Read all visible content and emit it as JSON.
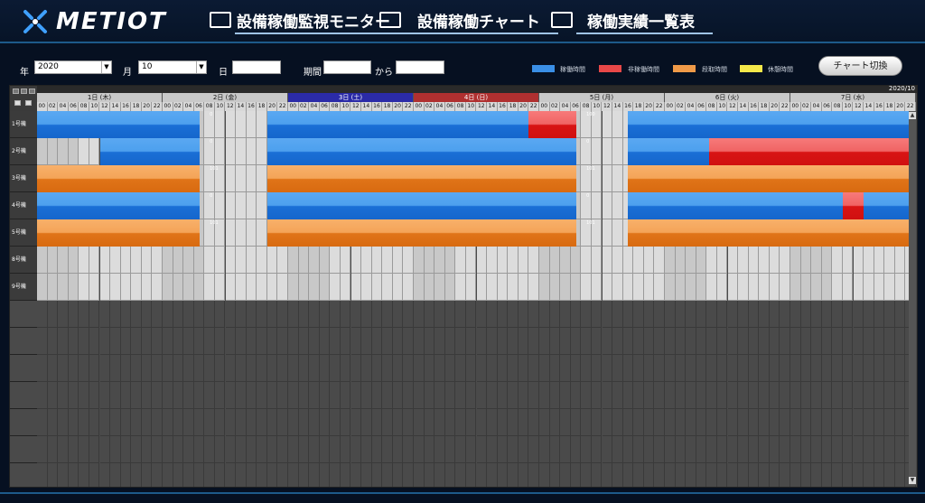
{
  "app": {
    "logo_text": "METIOT"
  },
  "nav": [
    {
      "label": "設備稼働監視モニター",
      "icon": "monitor-icon"
    },
    {
      "label": "設備稼働チャート",
      "icon": "chart-icon"
    },
    {
      "label": "稼働実績一覧表",
      "icon": "list-icon"
    }
  ],
  "filter": {
    "year_label": "年",
    "year_value": "2020",
    "month_label": "月",
    "month_value": "10",
    "day_label": "日",
    "day_value": "",
    "period_label": "期間",
    "period_from": "",
    "from_label": "から",
    "period_to": ""
  },
  "legend": [
    {
      "label": "稼働時間",
      "color": "#3a8fe6"
    },
    {
      "label": "非稼働時間",
      "color": "#e84848"
    },
    {
      "label": "段取時間",
      "color": "#f09a48"
    },
    {
      "label": "休憩時間",
      "color": "#f4e84a"
    }
  ],
  "chart_switch_label": "チャート切換",
  "gantt": {
    "year_month": "2020/10",
    "days": [
      {
        "label": "1日 (木)",
        "bg": "#c9c9c9"
      },
      {
        "label": "2日 (金)",
        "bg": "#c9c9c9"
      },
      {
        "label": "3日 (土)",
        "bg": "#2b2ba8"
      },
      {
        "label": "4日 (日)",
        "bg": "#b03030"
      },
      {
        "label": "5日 (月)",
        "bg": "#c9c9c9"
      },
      {
        "label": "6日 (火)",
        "bg": "#c9c9c9"
      },
      {
        "label": "7日 (水)",
        "bg": "#c9c9c9"
      }
    ],
    "hours": [
      "00",
      "02",
      "04",
      "06",
      "08",
      "10",
      "12",
      "14",
      "16",
      "18",
      "20",
      "22"
    ],
    "machines": [
      {
        "label": "1号機",
        "segments": [
          {
            "type": "run",
            "start": 0,
            "end": 31
          },
          {
            "type": "run",
            "start": 44,
            "end": 94
          },
          {
            "type": "stop",
            "start": 94,
            "end": 103
          },
          {
            "type": "run",
            "start": 113,
            "end": 168
          }
        ],
        "marks": [
          {
            "text": "0",
            "at": 33
          },
          {
            "text": "100",
            "at": 105
          }
        ]
      },
      {
        "label": "2号機",
        "segments": [
          {
            "type": "run",
            "start": 12,
            "end": 31
          },
          {
            "type": "run",
            "start": 44,
            "end": 103
          },
          {
            "type": "run",
            "start": 113,
            "end": 128.5
          },
          {
            "type": "stop",
            "start": 128.5,
            "end": 168
          }
        ],
        "marks": [
          {
            "text": "0",
            "at": 33
          },
          {
            "text": "0",
            "at": 105
          }
        ]
      },
      {
        "label": "3号機",
        "segments": [
          {
            "type": "setup",
            "start": 0,
            "end": 31
          },
          {
            "type": "setup",
            "start": 44,
            "end": 103
          },
          {
            "type": "setup",
            "start": 113,
            "end": 168
          }
        ],
        "marks": [
          {
            "text": "101",
            "at": 33
          },
          {
            "text": "101",
            "at": 105
          }
        ]
      },
      {
        "label": "4号機",
        "segments": [
          {
            "type": "run",
            "start": 0,
            "end": 31
          },
          {
            "type": "run",
            "start": 44,
            "end": 103
          },
          {
            "type": "run",
            "start": 113,
            "end": 154
          },
          {
            "type": "stop",
            "start": 154,
            "end": 158
          },
          {
            "type": "run",
            "start": 158,
            "end": 168
          }
        ],
        "marks": [
          {
            "text": "0",
            "at": 33
          },
          {
            "text": "0",
            "at": 105
          }
        ]
      },
      {
        "label": "5号機",
        "segments": [
          {
            "type": "setup",
            "start": 0,
            "end": 31
          },
          {
            "type": "setup",
            "start": 44,
            "end": 103
          },
          {
            "type": "setup",
            "start": 113,
            "end": 168
          }
        ],
        "marks": [
          {
            "text": "101",
            "at": 33
          },
          {
            "text": "101",
            "at": 105
          }
        ]
      },
      {
        "label": "8号機",
        "segments": [],
        "marks": []
      },
      {
        "label": "9号機",
        "segments": [],
        "marks": []
      }
    ]
  }
}
